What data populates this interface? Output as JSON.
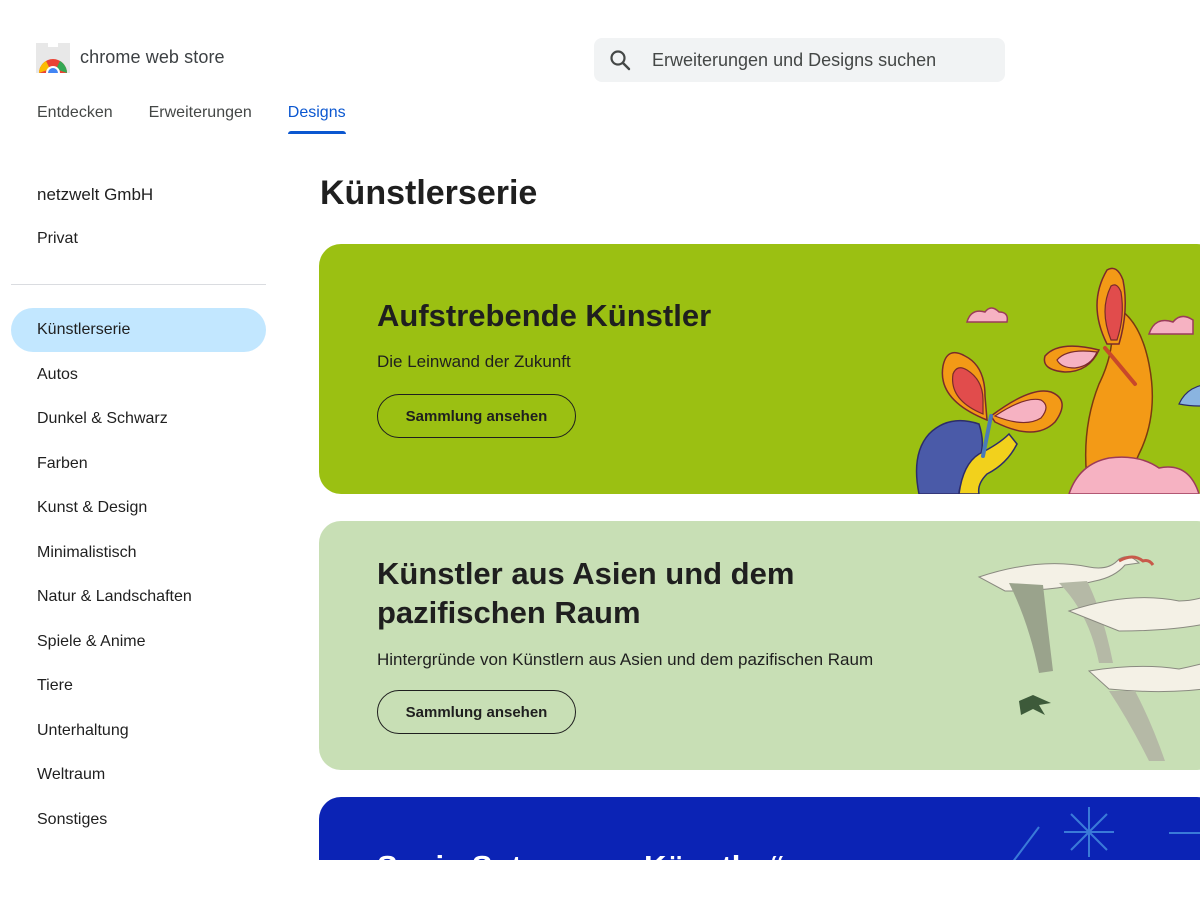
{
  "header": {
    "brand": "chrome web store",
    "search_placeholder": "Erweiterungen und Designs suchen",
    "logo_icon": "chrome-web-store-logo",
    "search_icon": "search-icon"
  },
  "tabs": [
    {
      "label": "Entdecken",
      "active": false
    },
    {
      "label": "Erweiterungen",
      "active": false
    },
    {
      "label": "Designs",
      "active": true
    }
  ],
  "sidebar": {
    "account": "netzwelt GmbH",
    "account_sub": "Privat",
    "categories": [
      {
        "label": "Künstlerserie",
        "active": true
      },
      {
        "label": "Autos"
      },
      {
        "label": "Dunkel & Schwarz"
      },
      {
        "label": "Farben"
      },
      {
        "label": "Kunst & Design"
      },
      {
        "label": "Minimalistisch"
      },
      {
        "label": "Natur & Landschaften"
      },
      {
        "label": "Spiele & Anime"
      },
      {
        "label": "Tiere"
      },
      {
        "label": "Unterhaltung"
      },
      {
        "label": "Weltraum"
      },
      {
        "label": "Sonstiges"
      }
    ]
  },
  "main": {
    "title": "Künstlerserie",
    "cards": [
      {
        "title": "Aufstrebende Künstler",
        "subtitle": "Die Leinwand der Zukunft",
        "button": "Sammlung ansehen",
        "bg_color": "#9bc012"
      },
      {
        "title": "Künstler aus Asien und dem pazifischen Raum",
        "subtitle": "Hintergründe von Künstlern aus Asien und dem pazifischen Raum",
        "button": "Sammlung ansehen",
        "bg_color": "#c8dfb5"
      },
      {
        "title": "Sonia-Sotomayor-Künstler“",
        "bg_color": "#0b23b5"
      }
    ]
  },
  "colors": {
    "accent": "#0b57d0",
    "active_category_bg": "#c2e7ff",
    "search_bg": "#f1f3f4"
  }
}
